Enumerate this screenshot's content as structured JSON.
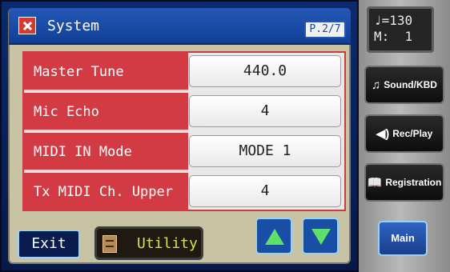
{
  "header": {
    "title": "System",
    "page": "P.2/7",
    "icon": "system-icon"
  },
  "params": [
    {
      "label": "Master Tune",
      "value": "440.0"
    },
    {
      "label": "Mic Echo",
      "value": "4"
    },
    {
      "label": "MIDI IN Mode",
      "value": "MODE 1"
    },
    {
      "label": "Tx MIDI Ch. Upper",
      "value": "4"
    }
  ],
  "footer": {
    "exit_label": "Exit",
    "utility_label": "Utility",
    "utility_icon": "utility-icon",
    "up_icon": "up-arrow-icon",
    "down_icon": "down-arrow-icon"
  },
  "side_panel": {
    "tempo_line1": "♩=130",
    "tempo_line2": "M:  1",
    "buttons": [
      {
        "label": "Sound/KBD",
        "icon": "♫"
      },
      {
        "label": "Rec/Play",
        "icon": "◀)"
      },
      {
        "label": "Registration",
        "icon": "📖"
      }
    ],
    "main_label": "Main"
  },
  "colors": {
    "title_bar": "#2458b7",
    "param_label_bg": "#d23b43",
    "arrow_green": "#5fe06a",
    "utility_text": "#d8e04f"
  }
}
